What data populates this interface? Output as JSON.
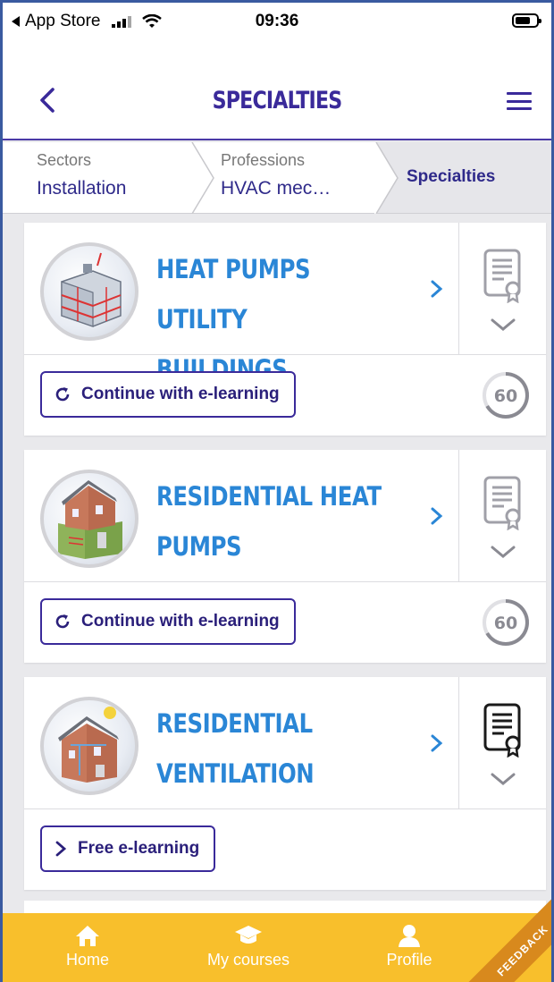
{
  "status_bar": {
    "back_app": "App Store",
    "time": "09:36"
  },
  "header": {
    "title": "SPECIALTIES"
  },
  "breadcrumb": {
    "items": [
      {
        "label": "Sectors",
        "value": "Installation"
      },
      {
        "label": "Professions",
        "value": "HVAC mec…"
      },
      {
        "label": "Specialties",
        "value": ""
      }
    ]
  },
  "cards": [
    {
      "title": "HEAT PUMPS UTILITY BUILDINGS",
      "action_label": "Continue with e-learning",
      "action_icon": "refresh-icon",
      "progress": "60",
      "certificate": "inactive"
    },
    {
      "title": "RESIDENTIAL HEAT PUMPS",
      "action_label": "Continue with e-learning",
      "action_icon": "refresh-icon",
      "progress": "60",
      "certificate": "inactive"
    },
    {
      "title": "RESIDENTIAL VENTILATION",
      "action_label": "Free e-learning",
      "action_icon": "chevron-right-icon",
      "progress": "",
      "certificate": "active"
    }
  ],
  "tabbar": {
    "items": [
      {
        "label": "Home",
        "icon": "home-icon"
      },
      {
        "label": "My courses",
        "icon": "graduation-cap-icon"
      },
      {
        "label": "Profile",
        "icon": "user-icon"
      }
    ],
    "feedback": "FEEDBACK"
  },
  "colors": {
    "primary": "#3a2a9a",
    "accent": "#2a86d6",
    "tabbar": "#f8bf2c",
    "feedback": "#d8891d"
  }
}
